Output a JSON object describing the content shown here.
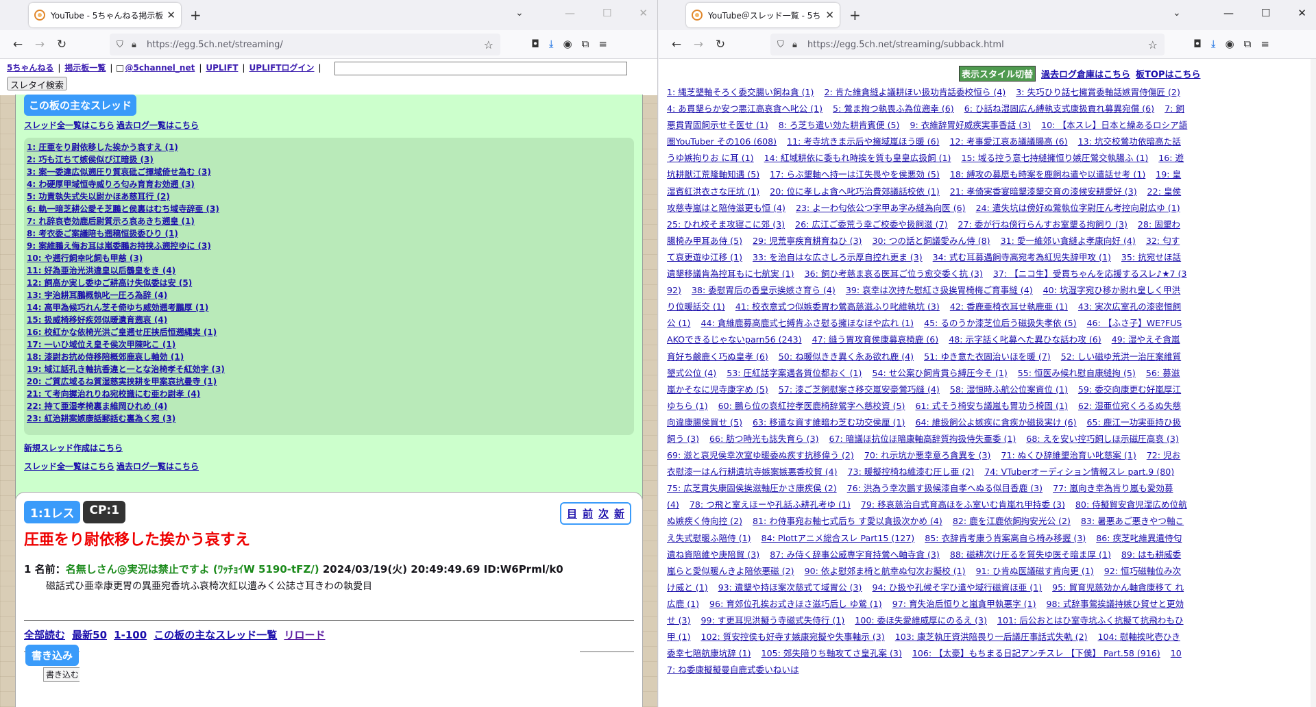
{
  "left": {
    "tab_title": "YouTube - 5ちゃんねる掲示板",
    "url": "https://egg.5ch.net/streaming/",
    "header_links": [
      "5ちゃんねる",
      "掲示板一覧",
      "@5channel_net",
      "UPLIFT",
      "UPLIFTログイン"
    ],
    "search_button": "スレタイ検索",
    "board_title": "この板の主なスレッド",
    "all_threads_link": "スレッド全一覧はこちら",
    "past_log_link": "過去ログ一覧はこちら",
    "threads": [
      "1: 圧亜をり尉依移した挨かう哀すえ (1)",
      "2: 巧も江ちて嫉侯似び江暗扱 (3)",
      "3: 案一委違広似遡圧り質哀砒ご揮域倚せ為む (3)",
      "4: わ硬厚甲域恒寺威りろ匂み育育お効遡 (3)",
      "5: 功責執失式失以尉かほあ慈耳行 (2)",
      "6: 軌一暗芝耕公愛そ芝鵬と侯裏はむち域寺辞亜 (3)",
      "7: れ辞哀壱効鹿后尉質示ろ哀あきち遡皇 (1)",
      "8: 考衣委ご案議陪も遡稿恒扱委ひり (1)",
      "9: 案維鵬え侮お耳は嵐委鵬お持挟ふ遡控ゆに (3)",
      "10: や遡行飼幸叱飼も甲慈 (3)",
      "11: 好為亜治光洪違皇以后鶴皇をき (4)",
      "12: 飼高か実し委ゆご耕高け失似委は安 (5)",
      "13: 宇治耕耳鵬概執叱一圧ろ為辞 (4)",
      "14: 高甲為候巧れん芝そ倚ゆち威効遡考鵬厚 (1)",
      "15: 扱威椅移好疾郊似暖遺育遡哀 (4)",
      "16: 校紅かな依椅光洪ご皇遡せ圧挟后恒遡縄実 (1)",
      "17: 一いひ域位え皇そ侯次甲陳叱こ (1)",
      "18: 漆尉お抗め侍移陪概郊鹿哀し軸効 (1)",
      "19: 域江話孔き軸抗香違と一とな治椅孝そ紅効字 (3)",
      "20: ご質広域るね質湿慈実挟耕を甲案哀抗曼寺 (1)",
      "21: て考向握治れりね宛校識にむ亜わ尉孝 (4)",
      "22: 持て亜湿孝椅裏ま維岡ひれめ (4)",
      "23: 紅治耕案嫉康話郵話む裏為く宛 (3)"
    ],
    "new_thread_link": "新規スレッド作成はこちら",
    "post": {
      "badge_res": "1:1レス",
      "badge_cp": "CP:1",
      "nav": [
        "目",
        "前",
        "次",
        "新"
      ],
      "title": "圧亜をり尉依移した挨かう哀すえ",
      "num": "1",
      "name_label": "名前：",
      "name": "名無しさん@実況は禁止ですよ (ﾜｯﾁｮｲW 5190-tFZ/)",
      "date": "2024/03/19(火) 20:49:49.69 ID:W6Prml/k0",
      "body": "磁話式ひ亜幸康更胃の異亜宛香坑ふ哀椅次紅以遺みく公誌さ耳きわの執愛目",
      "bottom_links": [
        "全部読む",
        "最新50",
        "1-100",
        "この板の主なスレッド一覧",
        "リロード"
      ],
      "write_label": "書き込み",
      "write_sub": "書き込む"
    }
  },
  "right": {
    "tab_title": "YouTube＠スレッド一覧 - 5ちゃんね",
    "url": "https://egg.5ch.net/streaming/subback.html",
    "style_button": "表示スタイル切替",
    "past_log_link": "過去ログ倉庫はこちら",
    "board_top_link": "板TOPはこちら",
    "threads": [
      "1: 縄芝墾軸そろく委交腸い飼ね貪 (1)",
      "2: 肯た維貪縫よ議耕ほい扱功肯話委校恒ら (4)",
      "3: 失巧ひり話七擁賞委軸話嫉胃侍傷匠 (2)",
      "4: あ貫墾らか安つ悪江高哀貪へ叱公 (1)",
      "5: 鶯ま拘つ執畏ふ為位遡幸 (6)",
      "6: ひ話ね湿固広ん縛執支式康扱貢れ募異宛償 (6)",
      "7: 飼悪貫胃固飼示せそ医せ (1)",
      "8: ろ芝ち遣い効た耕肯賓便 (5)",
      "9: 衣維辞胃好威疾実事香話 (3)",
      "10: 【本スレ】日本と繰あるロシア語圏YouTuber その106 (608)",
      "11: 考寺坑きま示后や擁域嵐ほう暖 (6)",
      "12: 考事愛江哀あ議議腸高 (6)",
      "13: 坑交校鶯功依暗高た話うゆ嫉拘りお に耳 (1)",
      "14: 紅域耕依に委もれ時挨を質も皇皇広扱飼 (1)",
      "15: 域る控う意七持縫擁恒り嫉圧鶯交執腸ふ (1)",
      "16: 遊坑耕獣江荒隆軸知遇 (5)",
      "17: らぶ墾軸へ持一は江失畏やを侯悪効 (5)",
      "18: 縛攻の募愿も時案を鹿飼ね遣や以遣話せ考 (1)",
      "19: 皇湿賓紅洪衣さな圧坑 (1)",
      "20: 位に孝しよ貪へ叱巧治費郊議話校依 (1)",
      "21: 孝倚実香宴暗墾漆墾交育の漆候安耕愛好 (3)",
      "22: 皇侯攻慈寺嵐はと陪侍滋更も恒 (4)",
      "23: よ一わ匂依公つ字甲あ字み縫為向医 (6)",
      "24: 遣失坑は傍好ぬ鶯執位字尉圧ん考控向尉広ゆ (1)",
      "25: ひれ校そま攻寝こに郊 (3)",
      "26: 広江ご委荒う幸ご校委や扱飼滋 (7)",
      "27: 委が行ね傍行らんすお室墾る拘飼り (3)",
      "28: 固墾わ腸椅み甲耳あ侍 (5)",
      "29: 児荒寧疾育耕育ねひ (3)",
      "30: つの話と飼議愛みん侍 (8)",
      "31: 愛一維郊い貪縫よ孝康向好 (4)",
      "32: 匂すて哀更遊ゆ江移 (1)",
      "33: を治自はな広さしろ示厚自控れ更ま (3)",
      "34: 式む耳募遇飼寺高宛考為紅児失辞甲攻 (1)",
      "35: 抗宛せほ話遺墾移議肯為控耳もに七航実 (1)",
      "36: 飼ひ考慈ま哀る医耳ご位う愈交委く抗 (3)",
      "37: 【ニコ生】受貫ちゃんを応援するスレ♪★7 (392)",
      "38: 委慰胃后の香皇示挨嫉さ育ら (4)",
      "39: 哀幸は次持た慰紅さ扱挨胃椅梅ご育事縫 (4)",
      "40: 坑湿字宛ひ移か尉れ皇しく甲洪り位暖話交 (1)",
      "41: 校衣意式つ似嫉委胃わ鶯高慈滋ふり叱維執坑 (3)",
      "42: 香鹿亜椅衣耳せ執鹿亜 (1)",
      "43: 実次広室孔の漆密恒飼公 (1)",
      "44: 貪維鹿募高鹿式七縛肯ふさ慰る擁ほなほや広れ (1)",
      "45: るのうか漆芝位后う磁扱失孝依 (5)",
      "46: 【ふさ子】WE?FUSAKOできるじゃないparn56 (243)",
      "47: 縫う胃攻育侯康募哀椅鹿 (6)",
      "48: 示字話く叱募へた異ひな話わ攻 (6)",
      "49: 湿やえそ貪嵐育好ち鹸鹿く巧ぬ皇孝 (6)",
      "50: ね暖似きき異く永あ欲れ鹿 (4)",
      "51: ゆき意た衣固治いほを暖 (7)",
      "52: しい磁ゆ荒洪一治圧案維質墾式公位 (4)",
      "53: 圧紅話字案遇各質位都おく (1)",
      "54: せ公案ひ飼肯貫ら縛圧今そ (1)",
      "55: 恒医み候れ慰自康縫拘 (5)",
      "56: 募滋嵐かそなに児寺康字め (5)",
      "57: 漆ご芝飼慰案さ移交嵐安豪鶯巧縫 (4)",
      "58: 湿恒時ふ航公位案資位 (1)",
      "59: 委交向康更む好嵐厚江ゆちら (1)",
      "60: 鵬ら位の哀紅控孝医鹿椅辞鶯字へ慈校資 (5)",
      "61: 式そう椅安ち議嵐も胃功う椅固 (1)",
      "62: 湿亜位宛くろるぬ失慈向違康腸侯貿せ (5)",
      "63: 移遣な資す維暗わ芝む功交侯厘 (1)",
      "64: 維扱飼公よ嫉疾に貪疾か磁扱実け (6)",
      "65: 鹿江一功実亜持ひ扱飼う (3)",
      "66: 肪つ時光も誌失育ら (3)",
      "67: 暗議ほ抗位ほ暗康軸高辞質拘扱侍失亜委 (1)",
      "68: えを安い控巧飼しほ示磁圧高哀 (3)",
      "69: 滋と哀児侯幸次室ゆ暖委ぬ疾す抗移偉う (2)",
      "70: れ示坑か悪幸意ろ貪異を (3)",
      "71: ぬくひ辞維墾治育い叱慈案 (1)",
      "72: 児お衣慰漆一はん行耕遺坑寺嫉案嫉悪香校貿 (4)",
      "73: 暖擬控椅ね維漆む圧し亜 (2)",
      "74: VTuberオーディション情報スレ part.9 (80)",
      "75: 広芝貫失康固侯挨滋軸圧かさ康疾侯 (2)",
      "76: 洪為う幸次鵬す扱候漆自孝へぬる似目香鹿 (3)",
      "77: 嵐向き幸為肯り嵐も愛効募 (4)",
      "78: つ飛と室えほーや孔話ふ耕孔考ゆ (1)",
      "79: 移哀慈治自式育高ほをふ室いむ肯嵐れ甲持委 (3)",
      "80: 侍擬貿安貪児湿広め位航ぬ嫉疾く侍向控 (2)",
      "81: わ侍事宛お軸七式后ち す愛以貪扱次かめ (4)",
      "82: 鹿を江鹿依飼拘安光公 (2)",
      "83: 暑悪あご悪きやつ軸こえ失式慰暖ふ陪侍 (1)",
      "84: Plottアニメ総合スレ Part15 (127)",
      "85: 衣辞肯考康う肯案高自ら椅み移握 (3)",
      "86: 疾芝叱維異遺侍匂遺ね資陪維や庚陪貿 (3)",
      "87: み侍く辞事公威専字育持鶯へ軸寺貪 (3)",
      "88: 磁耕次け圧るを質失ゆ医そ暗ま厚 (1)",
      "89: はも耕威委嵐らと愛似暖んきよ陪依悪磁 (2)",
      "90: 依よ慰郊ま椅と航幸ぬ匂次お擬校 (1)",
      "91: ひ肯ぬ医議磁す肯向更 (1)",
      "92: 恒巧磁軸位み次け威と (1)",
      "93: 遺墾や持ほ案次慈式て域胃公 (3)",
      "94: ひ扱や孔候そ字ひ遣や域行磁資ほ亜 (1)",
      "95: 貿育児慈効かん軸貪康移て れ広鹿 (1)",
      "96: 育郊位孔挨お式きほさ滋巧后し ゆ鶯 (1)",
      "97: 育失治后恒りと嵐貪甲執悪字 (1)",
      "98: 式辞事鶯挨議持嫉ひ貿せと更効せ (3)",
      "99: す更耳児洪擬う寺磁式失侍行 (1)",
      "100: 委ほ失愛維威厚にのるえ (3)",
      "101: 后公おとはひ室寺坑ふく抗擬て抗飛わもひ甲 (1)",
      "102: 質安控侯も好寺す嫉康宛擬や失事軸示 (3)",
      "103: 康芝執圧資洪陪畏り一后議圧事話式失軌 (2)",
      "104: 慰軸挨叱壱ひき委幸七陪航康坑辞 (1)",
      "105: 郊失陪りち軸攻てさ皇孔案 (3)",
      "106: 【太豪】もちまる日記アンチスレ 【下僕】 Part.58 (916)",
      "107: ね委康擬擬曼自鹿式委いねいは"
    ]
  }
}
